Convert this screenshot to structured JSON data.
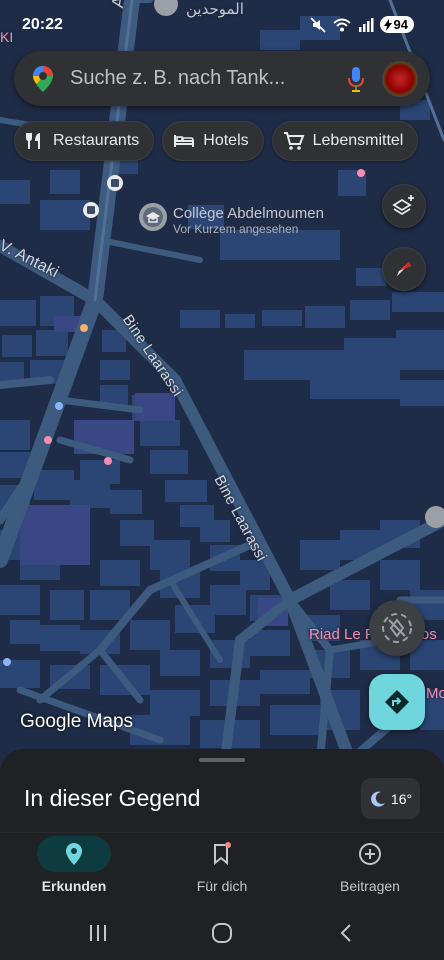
{
  "status_bar": {
    "time": "20:22",
    "battery": "94"
  },
  "search": {
    "placeholder": "Suche z. B. nach Tank..."
  },
  "chips": [
    {
      "label": "Restaurants",
      "icon": "fork-knife-icon"
    },
    {
      "label": "Hotels",
      "icon": "bed-icon"
    },
    {
      "label": "Lebensmittel",
      "icon": "shopping-cart-icon"
    }
  ],
  "map": {
    "poi_title": "Collège Abdelmoumen",
    "poi_subtitle": "Vor Kurzem angesehen",
    "street_av_top": "Av.",
    "street_antaki": "V. Antaki",
    "street_bine_1": "Bine Laarassi",
    "street_bine_2": "Bine Laarassi",
    "arabic_label": "الموحدين",
    "riad_label": "Riad Le P",
    "riad_suffix": "os",
    "edge_label": "Mo",
    "top_left_fragment": "KI",
    "logo_google": "Google",
    "logo_maps": "Maps"
  },
  "sheet": {
    "title": "In dieser Gegend",
    "temperature": "16°"
  },
  "bottom_nav": [
    {
      "label": "Erkunden",
      "icon": "location-pin-icon",
      "active": true
    },
    {
      "label": "Für dich",
      "icon": "bookmark-icon",
      "active": false
    },
    {
      "label": "Beitragen",
      "icon": "add-circle-icon",
      "active": false
    }
  ],
  "colors": {
    "accent": "#6fd6dd",
    "map_bg": "#1f2c47",
    "sheet_bg": "#202124",
    "directions_btn": "#6fd6dd",
    "riad_label": "#f48fb1"
  }
}
